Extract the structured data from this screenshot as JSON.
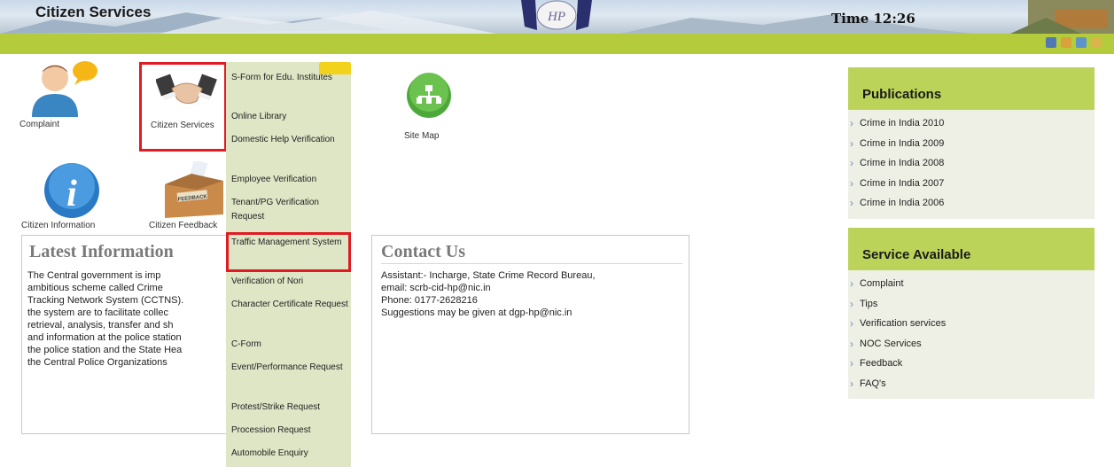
{
  "header": {
    "title": "Citizen Services",
    "time": "Time 12:26",
    "emblem_text": "HP"
  },
  "top_icons": [
    "monitor-icon",
    "user-group-icon",
    "user-icon",
    "home-icon"
  ],
  "tiles": {
    "complaint": "Complaint",
    "citizen_services": "Citizen Services",
    "site_map": "Site Map",
    "citizen_information": "Citizen Information",
    "citizen_feedback": "Citizen Feedback",
    "feedback_box_text": "FEEDBACK"
  },
  "menu": {
    "items": [
      "S-Form for Edu. Institutes",
      "Online Library",
      "Domestic Help Verification",
      "Employee Verification",
      "Tenant/PG Verification Request",
      "Traffic Management System",
      "Verification of Nori",
      "Character Certificate Request",
      "C-Form",
      "Event/Performance Request",
      "Protest/Strike Request",
      "Procession Request",
      "Automobile Enquiry"
    ]
  },
  "latest": {
    "title": "Latest Information",
    "lines": [
      "The Central government is imp",
      "ambitious scheme called Crime",
      "Tracking Network System (CCTNS).",
      "the system are to facilitate collec",
      "retrieval, analysis, transfer and sh",
      "and information at the police station",
      "the police station and the State Hea",
      "the Central Police Organizations"
    ]
  },
  "contact": {
    "title": "Contact Us",
    "lines": [
      "Assistant:- Incharge, State Crime Record Bureau,",
      "email: scrb-cid-hp@nic.in",
      "Phone: 0177-2628216",
      "Suggestions may be given at dgp-hp@nic.in"
    ]
  },
  "publications": {
    "title": "Publications",
    "items": [
      "Crime in India 2010",
      "Crime in India 2009",
      "Crime in India 2008",
      "Crime in India 2007",
      "Crime in India 2006"
    ]
  },
  "services": {
    "title": "Service Available",
    "items": [
      "Complaint",
      "Tips",
      "Verification services",
      "NOC Services",
      "Feedback",
      "FAQ's"
    ]
  },
  "colors": {
    "green_bar": "#b4cc3c",
    "highlight": "#e01b24",
    "menu_bg": "#dfe6c6",
    "panel_head": "#bcd35a"
  }
}
